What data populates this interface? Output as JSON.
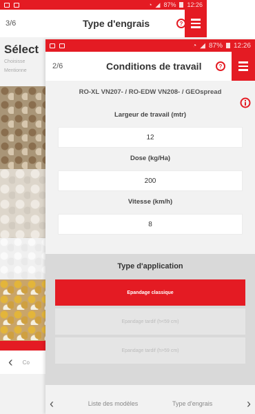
{
  "back_screen": {
    "status": {
      "percent": "87%",
      "time": "12:26"
    },
    "page_indicator": "3/6",
    "title": "Type d'engrais",
    "heading": "Sélect",
    "subtitle_line1": "Choisisse",
    "subtitle_line2": "Mentionne",
    "footer_label": "Co"
  },
  "front_screen": {
    "status": {
      "percent": "87%",
      "time": "12:26"
    },
    "page_indicator": "2/6",
    "title": "Conditions de travail",
    "model_line": "RO-XL VN207- / RO-EDW VN208- / GEOspread",
    "fields": [
      {
        "label": "Largeur de travail (mtr)",
        "value": "12"
      },
      {
        "label": "Dose (kg/Ha)",
        "value": "200"
      },
      {
        "label": "Vitesse (km/h)",
        "value": "8"
      }
    ],
    "application": {
      "title": "Type d'application",
      "options": [
        {
          "label": "Epandage classique",
          "state": "selected"
        },
        {
          "label": "Epandage tardif (h<59 cm)",
          "state": "disabled"
        },
        {
          "label": "Epandage tardif (h>59 cm)",
          "state": "disabled"
        }
      ]
    },
    "footer": {
      "prev_label": "Liste des modèles",
      "next_label": "Type d'engrais"
    }
  },
  "icons": {
    "help": "help-icon",
    "menu": "hamburger-menu-icon",
    "info": "info-icon",
    "prev": "chevron-left-icon",
    "next": "chevron-right-icon"
  },
  "colors": {
    "accent": "#e41b23",
    "background": "#f2f2f2"
  }
}
